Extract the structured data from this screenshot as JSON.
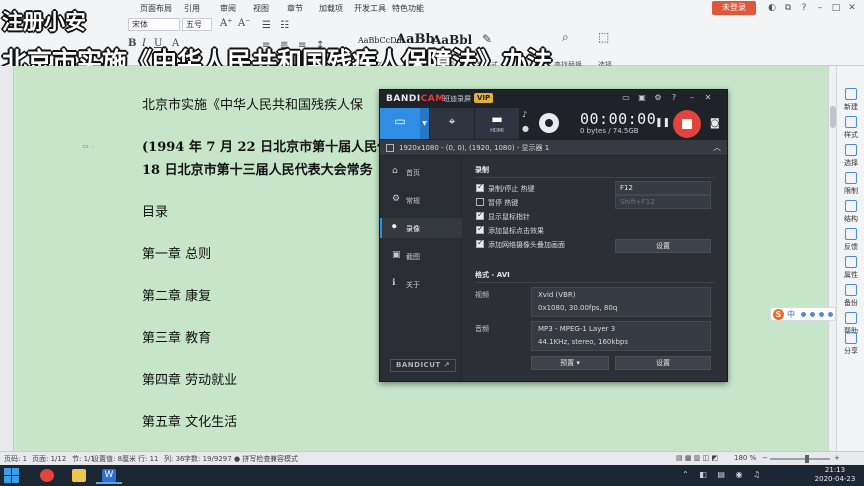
{
  "overlay": {
    "line1": "注册小安",
    "line2": "北京市实施《中华人民共和国残疾人保障法》办法"
  },
  "ribbon": {
    "tabs": [
      "页面布局",
      "引用",
      "审阅",
      "视图",
      "章节",
      "加载项",
      "开发工具",
      "特色功能"
    ],
    "login_label": "未登录",
    "font_name": "宋体",
    "font_size": "五号",
    "styles": [
      {
        "sample": "AaBbCcDd",
        "label": "正文"
      },
      {
        "sample": "AaBb",
        "label": "标题 1"
      },
      {
        "sample": "AaBbl",
        "label": "标题 2"
      }
    ],
    "new_style_label": "新样式",
    "find_replace_label": "查找替换",
    "select_label": "选择"
  },
  "document": {
    "line_title": "北京市实施《中华人民共和国残疾人保",
    "line_date1_pre": "(1994 年 7 月 22 日北京市第十届人民代",
    "line_date2": "18 日北京市第十三届人民代表大会常务",
    "toc_label": "目录",
    "chapters": [
      "第一章  总则",
      "第二章  康复",
      "第三章  教育",
      "第四章  劳动就业",
      "第五章  文化生活"
    ]
  },
  "right_pane": {
    "items": [
      "新建",
      "样式",
      "选择",
      "限制",
      "结构",
      "反馈",
      "属性",
      "备份",
      "帮助",
      "分享"
    ]
  },
  "ime": {
    "logo": "S",
    "mode": "中"
  },
  "bandicam": {
    "logo_main": "BANDI",
    "logo_accent": "CAM",
    "brand_tag": "班迪录屏",
    "vip": "VIP",
    "hdmi_label": "HDMI",
    "timer": "00:00:00",
    "size": "0 bytes / 74.5GB",
    "area": "1920x1080 - (0, 0), (1920, 1080) - 显示器 1",
    "nav": [
      {
        "icon": "⌂",
        "label": "首页"
      },
      {
        "icon": "⚙",
        "label": "常规"
      },
      {
        "icon": "⏺",
        "label": "录像"
      },
      {
        "icon": "▣",
        "label": "截图"
      },
      {
        "icon": "ℹ",
        "label": "关于"
      }
    ],
    "bandicut_label": "BANDICUT ↗",
    "record_section": "录制",
    "checkboxes": [
      {
        "label": "录制/停止 热键",
        "checked": true
      },
      {
        "label": "暂停 热键",
        "checked": false
      },
      {
        "label": "显示鼠标指针",
        "checked": true
      },
      {
        "label": "添加鼠标点击效果",
        "checked": true
      },
      {
        "label": "添加网络摄像头叠加画面",
        "checked": true
      }
    ],
    "hotkey_record": "F12",
    "hotkey_pause": "Shift+F12",
    "settings_label": "设置",
    "format_section": "格式 - AVI",
    "video_label": "视频",
    "video_codec": "Xvid (VBR)",
    "video_detail": "0x1080, 30.00fps, 80q",
    "audio_label": "音频",
    "audio_codec": "MP3 - MPEG-1 Layer 3",
    "audio_detail": "44.1KHz, stereo, 160kbps",
    "preset_label": "预置",
    "settings2_label": "设置"
  },
  "status": {
    "page": "页码: 1",
    "pages": "页面: 1/12",
    "section": "节: 1/1",
    "setting": "设置值: 8厘米",
    "row": "行: 11",
    "col": "列: 36",
    "words": "字数: 19/9297",
    "spell": "拼写检查",
    "compat": "兼容模式",
    "zoom": "180 %"
  },
  "taskbar": {
    "time": "21:13",
    "date": "2020-04-23"
  }
}
